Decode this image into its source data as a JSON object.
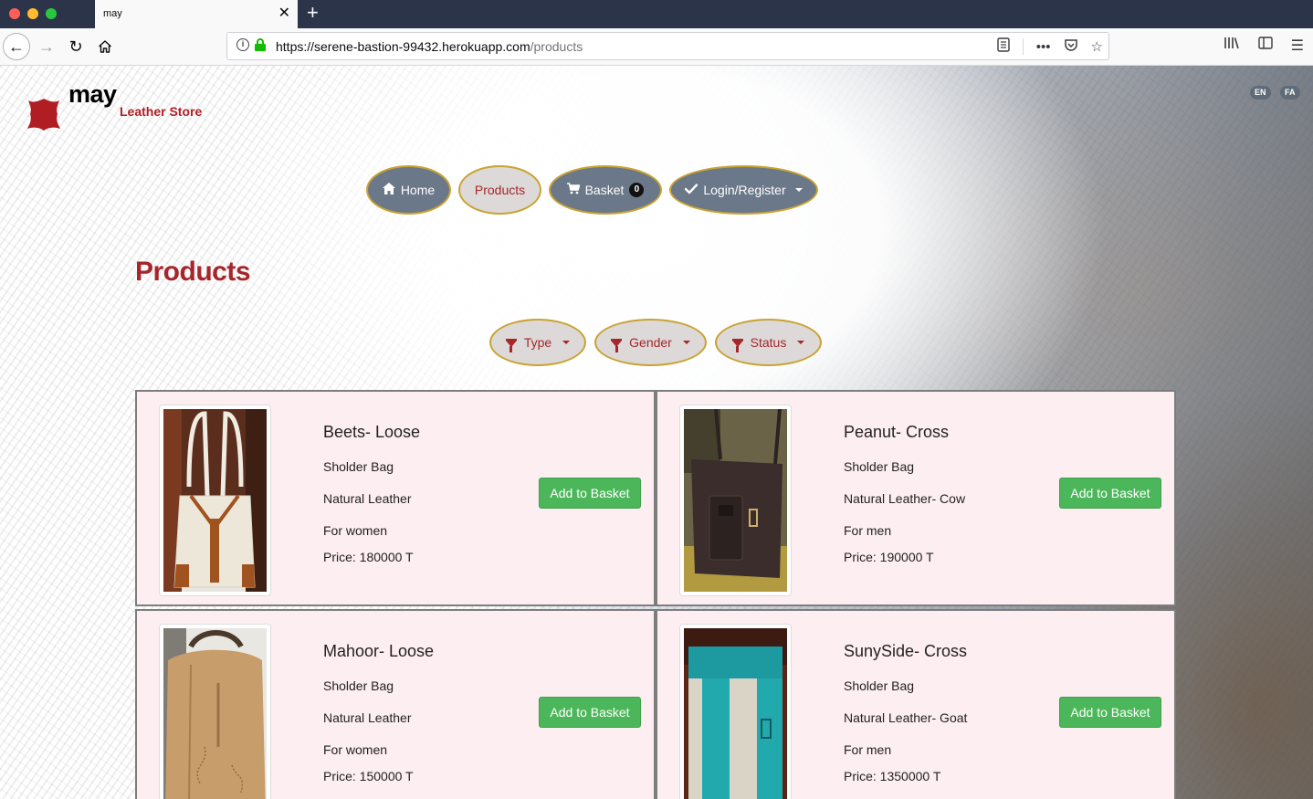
{
  "browser": {
    "tab_title": "may",
    "url_host": "https://serene-bastion-99432.herokuapp.com",
    "url_path": "/products"
  },
  "brand": {
    "name": "may",
    "subtitle": "Leather Store",
    "accent": "#a6262b"
  },
  "languages": [
    "EN",
    "FA"
  ],
  "nav": {
    "home": "Home",
    "products": "Products",
    "basket": "Basket",
    "basket_count": "0",
    "login": "Login/Register"
  },
  "page_title": "Products",
  "filters": {
    "type": "Type",
    "gender": "Gender",
    "status": "Status"
  },
  "products": [
    {
      "name": "Beets- Loose",
      "category": "Sholder Bag",
      "material": "Natural Leather",
      "for": "For  women",
      "price": "Price: 180000 T",
      "button": "Add to Basket"
    },
    {
      "name": "Peanut- Cross",
      "category": "Sholder Bag",
      "material": "Natural Leather- Cow",
      "for": "For  men",
      "price": "Price: 190000 T",
      "button": "Add to Basket"
    },
    {
      "name": "Mahoor- Loose",
      "category": "Sholder Bag",
      "material": "Natural Leather",
      "for": "For  women",
      "price": "Price: 150000 T",
      "button": "Add to Basket"
    },
    {
      "name": "SunySide- Cross",
      "category": "Sholder Bag",
      "material": "Natural Leather- Goat",
      "for": "For  men",
      "price": "Price: 1350000 T",
      "button": "Add to Basket"
    }
  ]
}
